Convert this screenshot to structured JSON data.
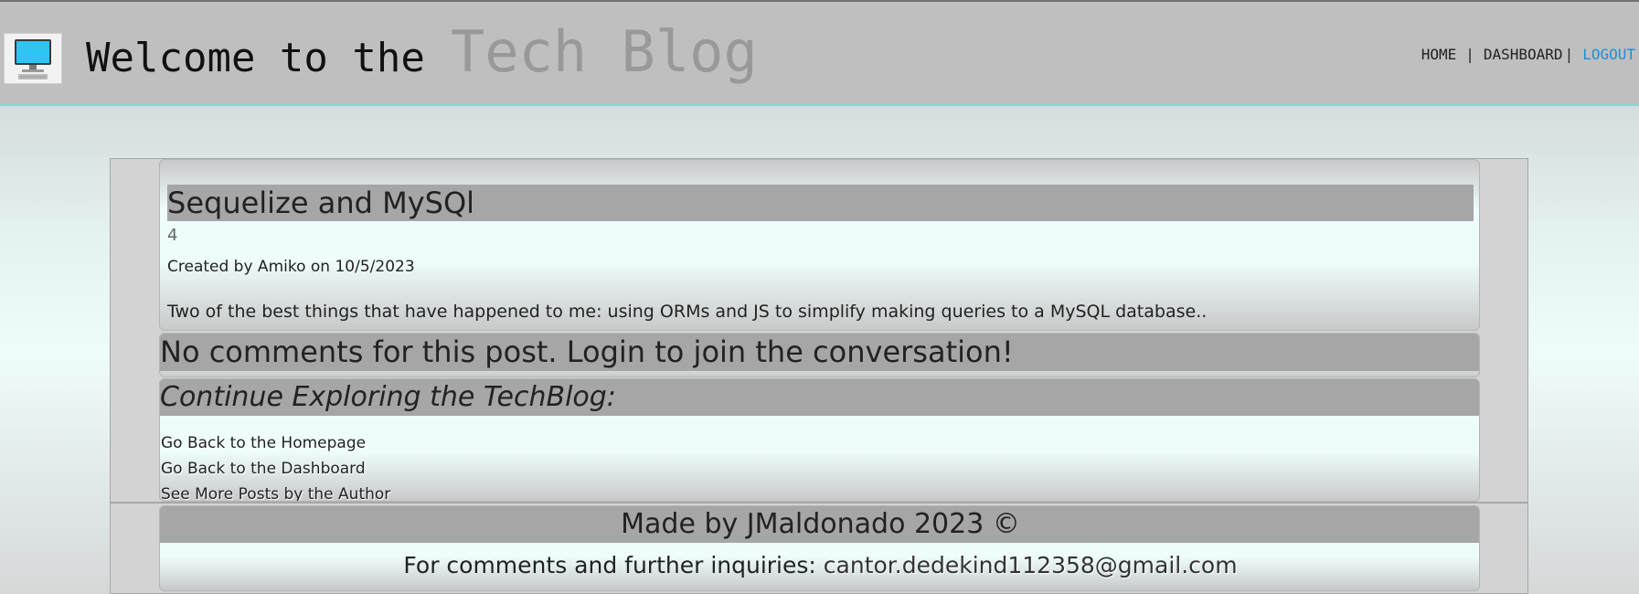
{
  "header": {
    "title_part1": "Welcome to the",
    "title_part2": "Tech Blog",
    "logo_icon": "computer-monitor-icon",
    "nav": {
      "home": "HOME",
      "separator": "|",
      "dashboard": "DASHBOARD",
      "logout": "LOGOUT"
    }
  },
  "post": {
    "title": "Sequelize and MySQl",
    "number": "4",
    "meta": "Created by Amiko on 10/5/2023",
    "body": "Two of the best things that have happened to me: using ORMs and JS to simplify making queries to a MySQL database.."
  },
  "comments": {
    "message": "No comments for this post. Login to join the conversation!"
  },
  "explore": {
    "heading": "Continue Exploring the TechBlog:",
    "links": [
      "Go Back to the Homepage",
      "Go Back to the Dashboard",
      "See More Posts by the Author"
    ]
  },
  "footer": {
    "made_by": "Made by JMaldonado 2023 ©",
    "contact_label": "For comments and further inquiries:",
    "email": "cantor.dedekind112358@gmail.com"
  },
  "colors": {
    "header_bg": "#bfbfbf",
    "accent_link": "#1f8fd4",
    "bar_bg": "#a6a6a6",
    "monitor_screen": "#2fc4f2"
  }
}
